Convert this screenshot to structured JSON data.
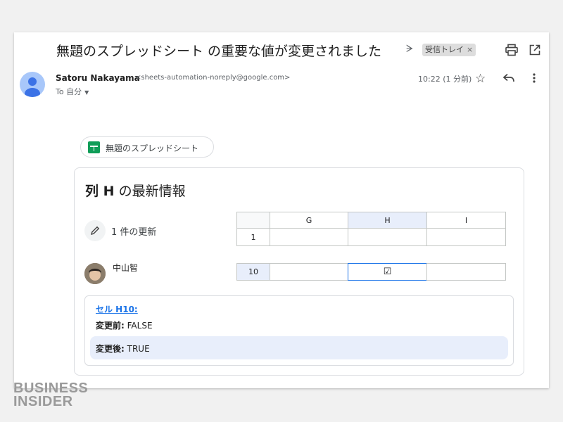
{
  "email": {
    "subject": "無題のスプレッドシート の重要な値が変更されました",
    "inbox_chip": "受信トレイ",
    "inbox_chip_close": "×",
    "sender_name": "Satoru Nakayama",
    "sender_email": "<sheets-automation-noreply@google.com>",
    "to_label": "To 自分",
    "time": "10:22 (1 分前)"
  },
  "body": {
    "doc_chip_label": "無題のスプレッドシート",
    "card": {
      "title_bold": "列 H",
      "title_rest": " の最新情報",
      "update_count": "1 件の更新",
      "user_name": "中山智",
      "columns": [
        "G",
        "H",
        "I"
      ],
      "header_row_number": "1",
      "changed_row_number": "10",
      "changed_cell_value": "☑",
      "cell_link": "セル H10:",
      "before_label": "変更前:",
      "before_value": " FALSE",
      "after_label": "変更後:",
      "after_value": " TRUE"
    }
  },
  "logo": {
    "line1": "BUSINESS",
    "line2": "INSIDER"
  },
  "icons": [
    "label-icon",
    "print-icon",
    "popout-icon",
    "avatar",
    "star-icon",
    "reply-icon",
    "more-icon",
    "sheets-icon",
    "edit-icon",
    "user-avatar"
  ],
  "colors": {
    "accent": "#1a73e8",
    "highlight": "#e8eefb",
    "sheets_green": "#0f9d58"
  }
}
